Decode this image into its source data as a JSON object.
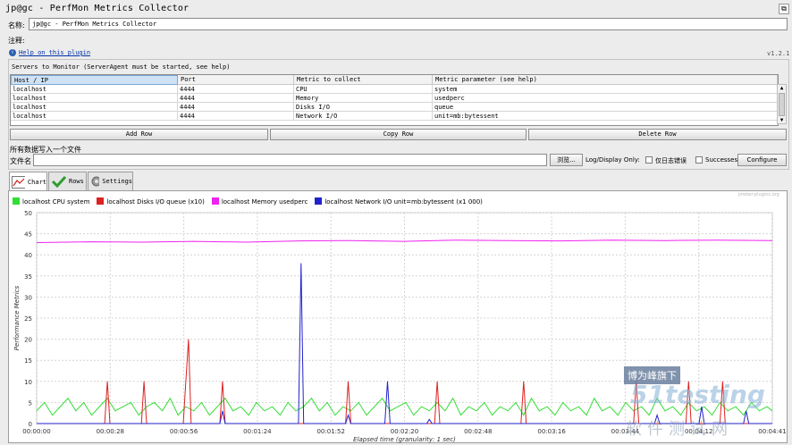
{
  "window": {
    "title": "jp@gc - PerfMon Metrics Collector",
    "corner_icon": "maximize-icon"
  },
  "form": {
    "name_label": "名称:",
    "name_value": "jp@gc - PerfMon Metrics Collector",
    "comment_label": "注释:",
    "help_link": "Help on this plugin",
    "version": "v1.2.1"
  },
  "servers": {
    "title": "Servers to Monitor (ServerAgent must be started, see help)",
    "columns": [
      "Host / IP",
      "Port",
      "Metric to collect",
      "Metric parameter (see help)"
    ],
    "rows": [
      [
        "localhost",
        "4444",
        "CPU",
        "system"
      ],
      [
        "localhost",
        "4444",
        "Memory",
        "usedperc"
      ],
      [
        "localhost",
        "4444",
        "Disks I/O",
        "queue"
      ],
      [
        "localhost",
        "4444",
        "Network I/O",
        "unit=mb:bytessent"
      ]
    ],
    "buttons": {
      "add": "Add Row",
      "copy": "Copy Row",
      "delete": "Delete Row"
    }
  },
  "file": {
    "section_label": "所有数据写入一个文件",
    "filename_label": "文件名",
    "browse": "浏览...",
    "log_display": "Log/Display Only:",
    "errors_only": "仅日志错误",
    "successes": "Successes",
    "configure": "Configure"
  },
  "tabs": [
    {
      "label": "Chart",
      "icon": "chart-icon"
    },
    {
      "label": "Rows",
      "icon": "checkmark-icon"
    },
    {
      "label": "Settings",
      "icon": "gear-icon"
    }
  ],
  "watermark": {
    "line1": "博为峰旗下",
    "line2": "51testing",
    "line3": "软件测试网",
    "small": "jmeter-plugins.org"
  },
  "colors": {
    "cpu": "#33dd33",
    "disks": "#dd2222",
    "memory": "#ee22ee",
    "network": "#2222cc"
  },
  "chart_data": {
    "type": "line",
    "title": "",
    "xlabel": "Elapsed time (granularity: 1 sec)",
    "ylabel": "Performance Metrics",
    "ylim": [
      0,
      50
    ],
    "yticks": [
      0,
      5,
      10,
      15,
      20,
      25,
      30,
      35,
      40,
      45,
      50
    ],
    "xlim": [
      0,
      281
    ],
    "xtick_labels": [
      "00:00:00",
      "00:00:28",
      "00:00:56",
      "00:01:24",
      "00:01:52",
      "00:02:20",
      "00:02:48",
      "00:03:16",
      "00:03:44",
      "00:04:12",
      "00:04:41"
    ],
    "grid": true,
    "legend_position": "top-left",
    "series": [
      {
        "name": "localhost CPU system",
        "color": "#33dd33",
        "points": [
          [
            0,
            3
          ],
          [
            3,
            5
          ],
          [
            6,
            2
          ],
          [
            9,
            4
          ],
          [
            12,
            6
          ],
          [
            15,
            3
          ],
          [
            18,
            5
          ],
          [
            21,
            2
          ],
          [
            24,
            4
          ],
          [
            27,
            6
          ],
          [
            30,
            3
          ],
          [
            33,
            4
          ],
          [
            36,
            5
          ],
          [
            39,
            2
          ],
          [
            42,
            4
          ],
          [
            45,
            5
          ],
          [
            48,
            3
          ],
          [
            51,
            6
          ],
          [
            54,
            2
          ],
          [
            57,
            4
          ],
          [
            60,
            3
          ],
          [
            63,
            5
          ],
          [
            66,
            2
          ],
          [
            69,
            4
          ],
          [
            72,
            6
          ],
          [
            75,
            3
          ],
          [
            78,
            4
          ],
          [
            81,
            2
          ],
          [
            84,
            5
          ],
          [
            87,
            3
          ],
          [
            90,
            4
          ],
          [
            93,
            2
          ],
          [
            96,
            5
          ],
          [
            99,
            3
          ],
          [
            102,
            4
          ],
          [
            105,
            6
          ],
          [
            108,
            3
          ],
          [
            111,
            5
          ],
          [
            114,
            2
          ],
          [
            117,
            4
          ],
          [
            120,
            3
          ],
          [
            123,
            5
          ],
          [
            126,
            2
          ],
          [
            129,
            4
          ],
          [
            132,
            6
          ],
          [
            135,
            3
          ],
          [
            138,
            4
          ],
          [
            141,
            5
          ],
          [
            144,
            2
          ],
          [
            147,
            4
          ],
          [
            150,
            3
          ],
          [
            153,
            5
          ],
          [
            156,
            3
          ],
          [
            159,
            6
          ],
          [
            162,
            2
          ],
          [
            165,
            4
          ],
          [
            168,
            3
          ],
          [
            171,
            5
          ],
          [
            174,
            2
          ],
          [
            177,
            4
          ],
          [
            180,
            3
          ],
          [
            183,
            5
          ],
          [
            186,
            2
          ],
          [
            189,
            6
          ],
          [
            192,
            3
          ],
          [
            195,
            4
          ],
          [
            198,
            2
          ],
          [
            201,
            5
          ],
          [
            204,
            3
          ],
          [
            207,
            4
          ],
          [
            210,
            2
          ],
          [
            213,
            6
          ],
          [
            216,
            3
          ],
          [
            219,
            4
          ],
          [
            222,
            2
          ],
          [
            225,
            5
          ],
          [
            228,
            3
          ],
          [
            231,
            4
          ],
          [
            234,
            2
          ],
          [
            237,
            6
          ],
          [
            240,
            3
          ],
          [
            243,
            4
          ],
          [
            246,
            2
          ],
          [
            249,
            5
          ],
          [
            252,
            3
          ],
          [
            255,
            4
          ],
          [
            258,
            2
          ],
          [
            261,
            5
          ],
          [
            264,
            3
          ],
          [
            267,
            4
          ],
          [
            270,
            2
          ],
          [
            273,
            5
          ],
          [
            276,
            3
          ],
          [
            279,
            4
          ],
          [
            281,
            3
          ]
        ]
      },
      {
        "name": "localhost Disks I/O queue (x10)",
        "color": "#dd2222",
        "points": [
          [
            0,
            0
          ],
          [
            26,
            0
          ],
          [
            27,
            10
          ],
          [
            28,
            0
          ],
          [
            40,
            0
          ],
          [
            41,
            10
          ],
          [
            42,
            0
          ],
          [
            56,
            0
          ],
          [
            57,
            10
          ],
          [
            58,
            20
          ],
          [
            59,
            0
          ],
          [
            70,
            0
          ],
          [
            71,
            10
          ],
          [
            72,
            0
          ],
          [
            118,
            0
          ],
          [
            119,
            10
          ],
          [
            120,
            0
          ],
          [
            152,
            0
          ],
          [
            153,
            10
          ],
          [
            154,
            0
          ],
          [
            185,
            0
          ],
          [
            186,
            10
          ],
          [
            187,
            0
          ],
          [
            228,
            0
          ],
          [
            229,
            10
          ],
          [
            230,
            0
          ],
          [
            248,
            0
          ],
          [
            249,
            10
          ],
          [
            250,
            0
          ],
          [
            261,
            0
          ],
          [
            262,
            10
          ],
          [
            263,
            0
          ],
          [
            281,
            0
          ]
        ]
      },
      {
        "name": "localhost Memory usedperc",
        "color": "#ee22ee",
        "points": [
          [
            0,
            42.9
          ],
          [
            20,
            43.1
          ],
          [
            40,
            43.0
          ],
          [
            60,
            43.2
          ],
          [
            80,
            43.0
          ],
          [
            100,
            43.3
          ],
          [
            120,
            43.4
          ],
          [
            140,
            43.2
          ],
          [
            160,
            43.5
          ],
          [
            180,
            43.4
          ],
          [
            200,
            43.3
          ],
          [
            220,
            43.5
          ],
          [
            240,
            43.4
          ],
          [
            260,
            43.5
          ],
          [
            281,
            43.4
          ]
        ]
      },
      {
        "name": "localhost Network I/O unit=mb:bytessent (x1 000)",
        "color": "#2222cc",
        "points": [
          [
            0,
            0
          ],
          [
            70,
            0
          ],
          [
            71,
            3
          ],
          [
            72,
            0
          ],
          [
            100,
            0
          ],
          [
            101,
            38
          ],
          [
            102,
            0
          ],
          [
            118,
            0
          ],
          [
            119,
            2
          ],
          [
            120,
            0
          ],
          [
            133,
            0
          ],
          [
            134,
            10
          ],
          [
            135,
            0
          ],
          [
            149,
            0
          ],
          [
            150,
            1
          ],
          [
            151,
            0
          ],
          [
            236,
            0
          ],
          [
            237,
            2
          ],
          [
            238,
            0
          ],
          [
            253,
            0
          ],
          [
            254,
            4
          ],
          [
            255,
            0
          ],
          [
            270,
            0
          ],
          [
            271,
            3
          ],
          [
            272,
            0
          ],
          [
            281,
            0
          ]
        ]
      }
    ]
  }
}
